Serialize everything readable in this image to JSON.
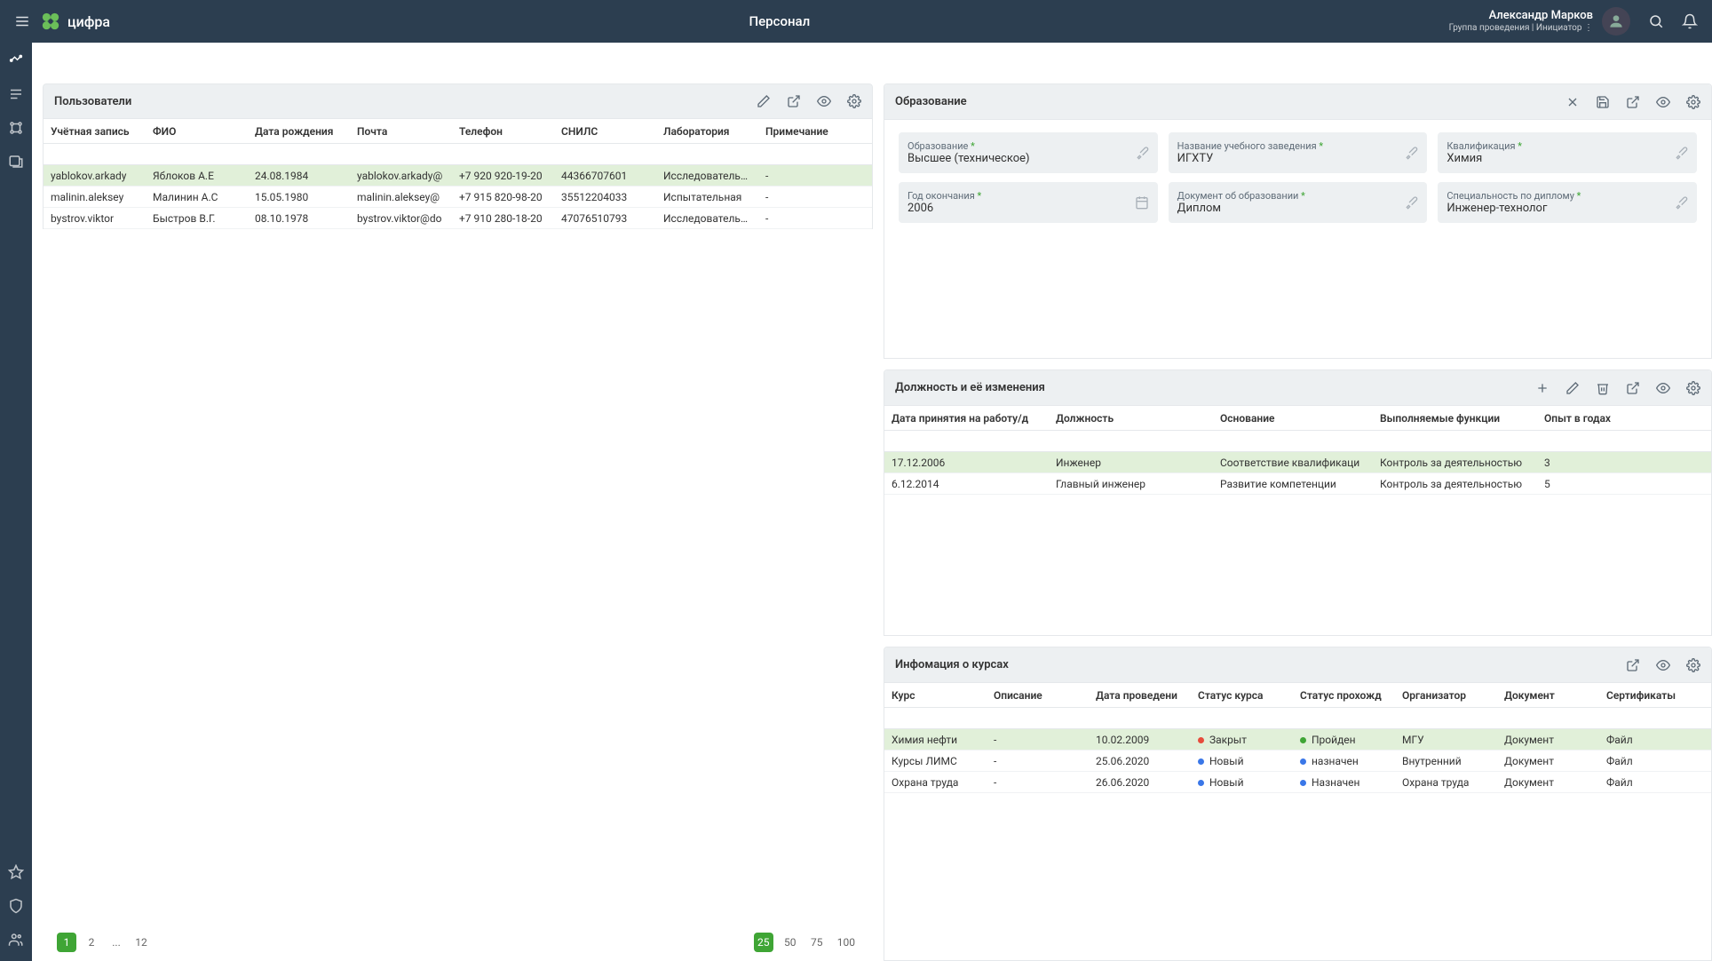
{
  "header": {
    "title": "Персонал",
    "brand": "цифра",
    "user_name": "Александр Марков",
    "user_role": "Группа проведения | Инициатор  ⋮"
  },
  "users_panel": {
    "title": "Пользователи",
    "columns": [
      "Учётная запись",
      "ФИО",
      "Дата рождения",
      "Почта",
      "Телефон",
      "СНИЛС",
      "Лаборатория",
      "Примечание"
    ],
    "rows": [
      {
        "account": "yablokov.arkady",
        "fio": "Яблоков А.Е",
        "dob": "24.08.1984",
        "email": "yablokov.arkady@",
        "phone": "+7 920 920-19-20",
        "snils": "44366707601",
        "lab": "Исследовательск",
        "note": "-",
        "hl": true
      },
      {
        "account": "malinin.aleksey",
        "fio": "Малинин А.С",
        "dob": "15.05.1980",
        "email": "malinin.aleksey@",
        "phone": "+7 915 820-98-20",
        "snils": "35512204033",
        "lab": "Испытательная",
        "note": "-",
        "hl": false
      },
      {
        "account": "bystrov.viktor",
        "fio": "Быстров В.Г.",
        "dob": "08.10.1978",
        "email": "bystrov.viktor@do",
        "phone": "+7 910 280-18-20",
        "snils": "47076510793",
        "lab": "Исследовательск",
        "note": "-",
        "hl": false
      }
    ],
    "pages": [
      "1",
      "2",
      "...",
      "12"
    ],
    "page_sizes": [
      "25",
      "50",
      "75",
      "100"
    ]
  },
  "education_panel": {
    "title": "Образование",
    "fields": {
      "education": {
        "label": "Образование",
        "value": "Высшее (техническое)",
        "req": true,
        "icon": "brush"
      },
      "institution": {
        "label": "Название учебного заведения",
        "value": "ИГХТУ",
        "req": true,
        "icon": "brush"
      },
      "qualification": {
        "label": "Квалификация",
        "value": "Химия",
        "req": true,
        "icon": "brush"
      },
      "grad_year": {
        "label": "Год окончания",
        "value": "2006",
        "req": true,
        "icon": "calendar"
      },
      "document": {
        "label": "Документ об образовании",
        "value": "Диплом",
        "req": true,
        "icon": "brush"
      },
      "specialty": {
        "label": "Специальность по диплому",
        "value": "Инженер-технолог",
        "req": true,
        "icon": "brush"
      }
    }
  },
  "position_panel": {
    "title": "Должность и её изменения",
    "columns": [
      "Дата принятия на работу/д",
      "Должность",
      "Основание",
      "Выполняемые функции",
      "Опыт в годах"
    ],
    "rows": [
      {
        "date": "17.12.2006",
        "pos": "Инженер",
        "basis": "Соответствие квалификаци",
        "func": "Контроль за деятельностью",
        "exp": "3",
        "hl": true
      },
      {
        "date": "6.12.2014",
        "pos": "Главный инженер",
        "basis": "Развитие компетенции",
        "func": "Контроль за деятельностью",
        "exp": "5",
        "hl": false
      }
    ]
  },
  "courses_panel": {
    "title": "Инфомация о курсах",
    "columns": [
      "Курс",
      "Описание",
      "Дата проведени",
      "Статус курса",
      "Статус прохожд",
      "Организатор",
      "Документ",
      "Сертификаты"
    ],
    "rows": [
      {
        "course": "Химия нефти",
        "desc": "-",
        "date": "10.02.2009",
        "status": "Закрыт",
        "status_color": "red",
        "pass": "Пройден",
        "pass_color": "green",
        "org": "МГУ",
        "doc": "Документ",
        "cert": "Файл",
        "hl": true
      },
      {
        "course": "Курсы ЛИМС",
        "desc": "-",
        "date": "25.06.2020",
        "status": "Новый",
        "status_color": "blue",
        "pass": "назначен",
        "pass_color": "blue",
        "org": "Внутренний",
        "doc": "Документ",
        "cert": "Файл",
        "hl": false
      },
      {
        "course": "Охрана труда",
        "desc": "-",
        "date": "26.06.2020",
        "status": "Новый",
        "status_color": "blue",
        "pass": "Назначен",
        "pass_color": "blue",
        "org": "Охрана труда",
        "doc": "Документ",
        "cert": "Файл",
        "hl": false
      }
    ]
  }
}
